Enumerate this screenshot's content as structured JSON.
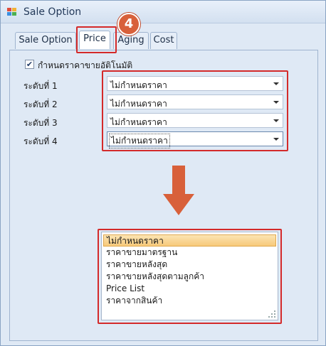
{
  "window": {
    "title": "Sale Option"
  },
  "tabs": [
    {
      "label": "Sale Option"
    },
    {
      "label": "Price"
    },
    {
      "label": "Aging"
    },
    {
      "label": "Cost"
    }
  ],
  "step_badge": "4",
  "auto_price": {
    "label": "กำหนดราคาขายอัติโนมัติ",
    "checked": true
  },
  "levels": [
    {
      "label": "ระดับที่ 1",
      "value": "ไม่กำหนดราคา"
    },
    {
      "label": "ระดับที่ 2",
      "value": "ไม่กำหนดราคา"
    },
    {
      "label": "ระดับที่ 3",
      "value": "ไม่กำหนดราคา"
    },
    {
      "label": "ระดับที่ 4",
      "value": "ไม่กำหนดราคา"
    }
  ],
  "dropdown_options": [
    "ไม่กำหนดราคา",
    "ราคาขายมาตรฐาน",
    "ราคาขายหลังสุด",
    "ราคาขายหลังสุดตามลูกค้า",
    "Price List",
    "ราคาจากสินค้า"
  ],
  "colors": {
    "highlight_red": "#d42a2a",
    "arrow_orange": "#d8603a",
    "selected_item": "#f7c97a"
  }
}
